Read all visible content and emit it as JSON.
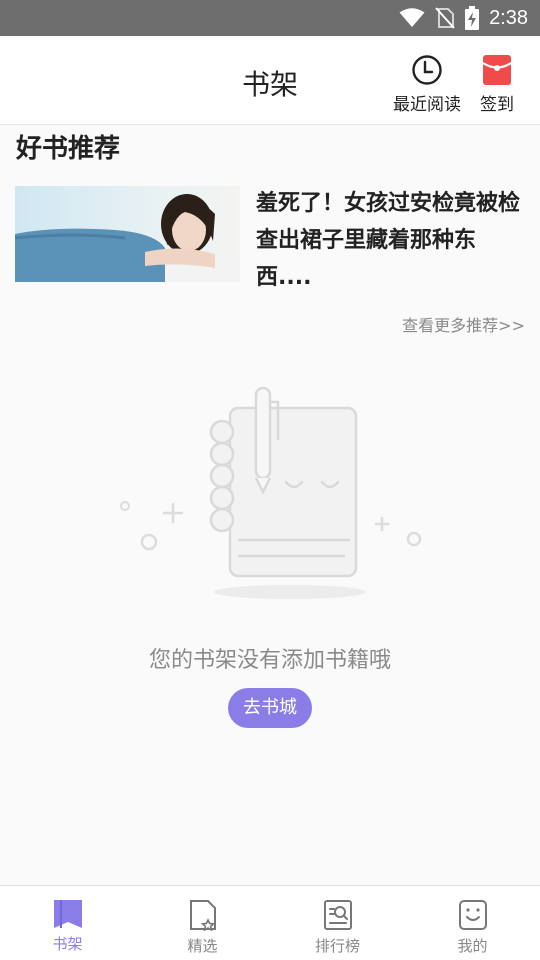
{
  "status_bar": {
    "time": "2:38",
    "icons": [
      "wifi-icon",
      "no-sim-icon",
      "battery-charging-icon"
    ]
  },
  "header": {
    "title": "书架",
    "recent_label": "最近阅读",
    "sign_label": "签到"
  },
  "recommend": {
    "title": "好书推荐",
    "book_title": "羞死了！女孩过安检竟被检查出裙子里藏着那种东西....",
    "more_label": "查看更多推荐>>"
  },
  "empty": {
    "message": "您的书架没有添加书籍哦",
    "button_label": "去书城"
  },
  "bottom_nav": {
    "items": [
      {
        "label": "书架",
        "icon": "bookshelf-icon",
        "active": true
      },
      {
        "label": "精选",
        "icon": "featured-icon",
        "active": false
      },
      {
        "label": "排行榜",
        "icon": "ranking-icon",
        "active": false
      },
      {
        "label": "我的",
        "icon": "profile-icon",
        "active": false
      }
    ]
  },
  "colors": {
    "accent": "#8b7de8",
    "sign_red": "#ef4b4b",
    "status_bar": "#6e6e6e"
  }
}
